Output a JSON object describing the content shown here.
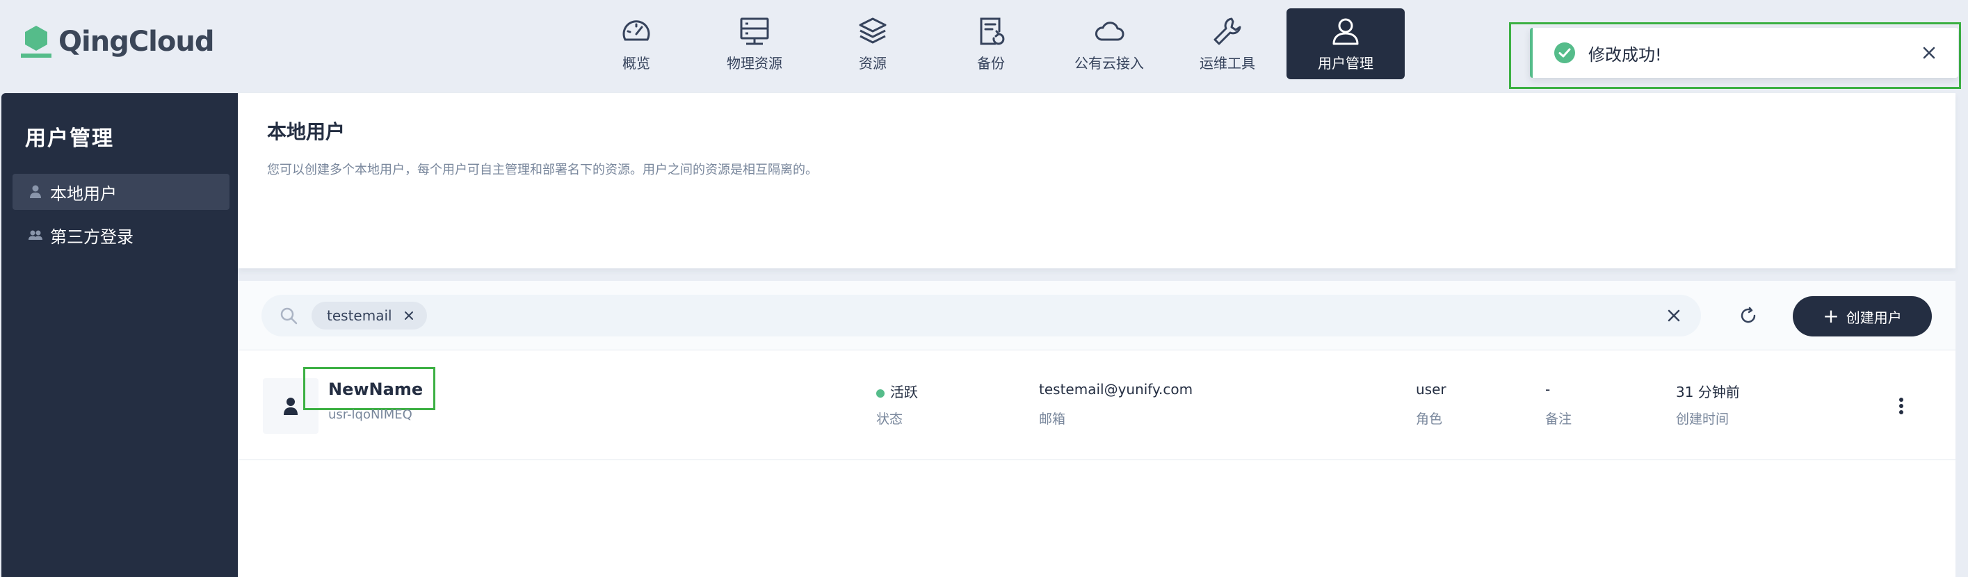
{
  "app": {
    "logo_text": "QingCloud",
    "brand_color": "#55bc8a"
  },
  "nav": {
    "items": [
      {
        "label": "概览",
        "icon": "gauge-icon"
      },
      {
        "label": "物理资源",
        "icon": "server-icon"
      },
      {
        "label": "资源",
        "icon": "layers-icon"
      },
      {
        "label": "备份",
        "icon": "backup-document-icon"
      },
      {
        "label": "公有云接入",
        "icon": "cloud-icon"
      },
      {
        "label": "运维工具",
        "icon": "wrench-icon"
      },
      {
        "label": "用户管理",
        "icon": "user-icon",
        "active": true
      }
    ]
  },
  "toast": {
    "message": "修改成功!",
    "type": "success",
    "color": "#55bc8a"
  },
  "sidebar": {
    "title": "用户管理",
    "items": [
      {
        "label": "本地用户",
        "icon": "person-icon",
        "active": true
      },
      {
        "label": "第三方登录",
        "icon": "people-icon",
        "active": false
      }
    ]
  },
  "header": {
    "title": "本地用户",
    "description": "您可以创建多个本地用户，每个用户可自主管理和部署名下的资源。用户之间的资源是相互隔离的。"
  },
  "toolbar": {
    "filter_tag": "testemail",
    "create_label": "创建用户"
  },
  "users": [
    {
      "name": "NewName",
      "id": "usr-lqoNIMEQ",
      "status": "活跃",
      "status_label": "状态",
      "email": "testemail@yunify.com",
      "email_label": "邮箱",
      "role": "user",
      "role_label": "角色",
      "note": "-",
      "note_label": "备注",
      "created": "31 分钟前",
      "created_label": "创建时间"
    }
  ]
}
